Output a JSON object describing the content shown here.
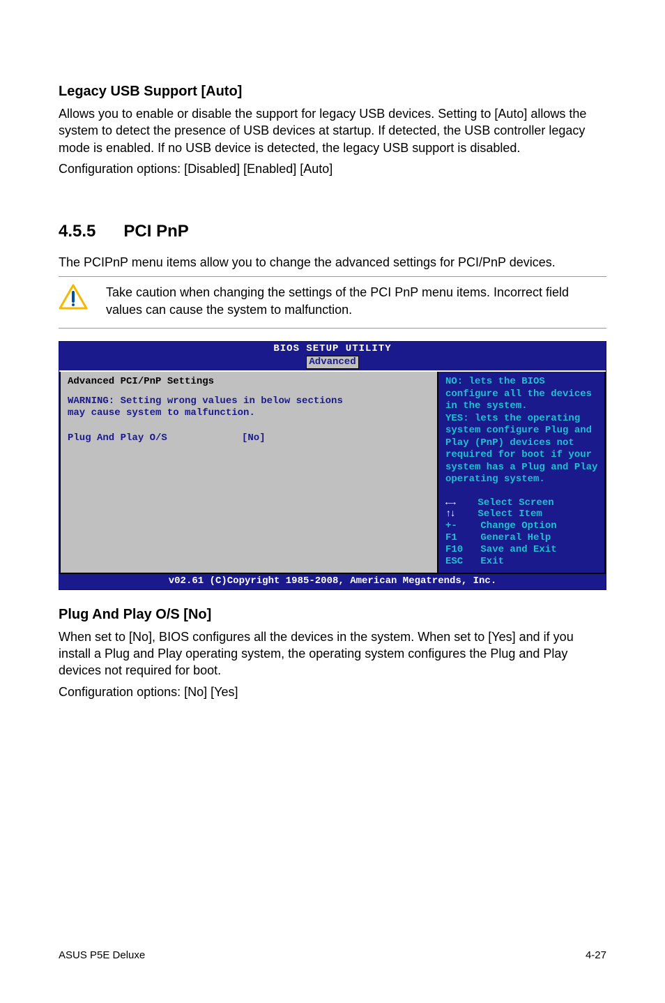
{
  "section1": {
    "title": "Legacy USB Support [Auto]",
    "para": "Allows you to enable or disable the support for legacy USB devices. Setting to [Auto] allows the system to detect the presence of USB devices at startup. If detected, the USB controller legacy mode is enabled. If no USB device is detected, the legacy USB support is disabled.",
    "cfg": "Configuration options: [Disabled] [Enabled] [Auto]"
  },
  "section2": {
    "num": "4.5.5",
    "title": "PCI PnP",
    "para": "The PCIPnP menu items allow you to change the advanced settings for PCI/PnP devices.",
    "note": "Take caution when changing the settings of the PCI PnP menu items. Incorrect field values can cause the system to malfunction."
  },
  "bios": {
    "header": "BIOS SETUP UTILITY",
    "tab": "Advanced",
    "left_title": "Advanced PCI/PnP Settings",
    "warn1": "WARNING: Setting wrong values in below sections",
    "warn2": "         may cause system to malfunction.",
    "opt_key": "Plug And Play O/S",
    "opt_val": "[No]",
    "help": "NO: lets the BIOS configure all the devices in the system.\nYES: lets the operating system configure Plug and Play (PnP) devices not required for boot if your system has a Plug and Play operating system.",
    "keys_arrows_lr": "←→",
    "keys_line1": "    Select Screen",
    "keys_arrows_ud": "↑↓",
    "keys_line2": "    Select Item",
    "keys_line3": "+-    Change Option",
    "keys_line4": "F1    General Help",
    "keys_line5": "F10   Save and Exit",
    "keys_line6": "ESC   Exit",
    "footer": "v02.61 (C)Copyright 1985-2008, American Megatrends, Inc."
  },
  "section3": {
    "title": "Plug And Play O/S [No]",
    "para": "When set to [No], BIOS configures all the devices in the system. When set to [Yes] and if you install a Plug and Play operating system, the operating system configures the Plug and Play devices not required for boot.",
    "cfg": "Configuration options: [No] [Yes]"
  },
  "footer": {
    "left": "ASUS P5E Deluxe",
    "right": "4-27"
  }
}
